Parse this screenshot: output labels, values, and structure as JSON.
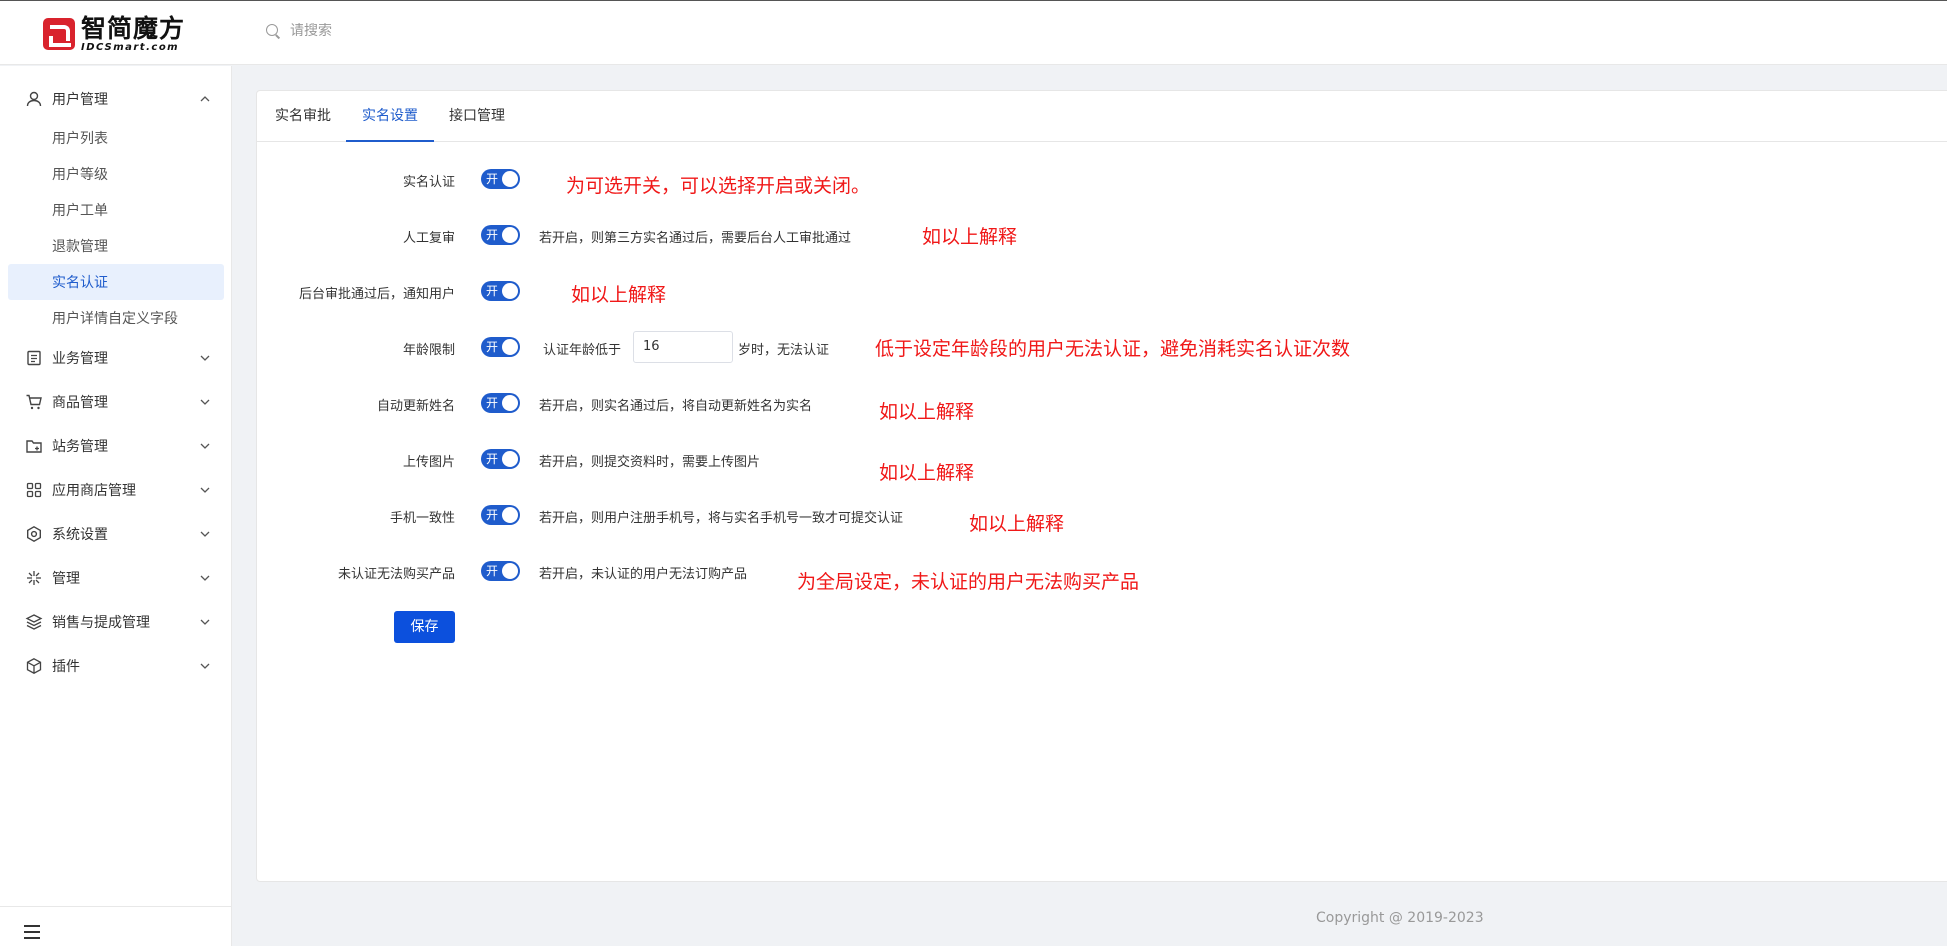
{
  "header": {
    "logo_cn": "智简魔方",
    "logo_en": "IDCSmart.com",
    "search_placeholder": "请搜索"
  },
  "sidebar": {
    "groups": [
      {
        "label": "用户管理",
        "icon": "user-icon",
        "expanded": true
      },
      {
        "label": "业务管理",
        "icon": "document-icon"
      },
      {
        "label": "商品管理",
        "icon": "cart-icon"
      },
      {
        "label": "站务管理",
        "icon": "folder-icon"
      },
      {
        "label": "应用商店管理",
        "icon": "apps-icon"
      },
      {
        "label": "系统设置",
        "icon": "settings-icon"
      },
      {
        "label": "管理",
        "icon": "sparkle-icon"
      },
      {
        "label": "销售与提成管理",
        "icon": "layers-icon"
      },
      {
        "label": "插件",
        "icon": "cube-icon"
      }
    ],
    "user_submenu": [
      {
        "label": "用户列表"
      },
      {
        "label": "用户等级"
      },
      {
        "label": "用户工单"
      },
      {
        "label": "退款管理"
      },
      {
        "label": "实名认证",
        "active": true
      },
      {
        "label": "用户详情自定义字段"
      }
    ]
  },
  "tabs": [
    {
      "label": "实名审批"
    },
    {
      "label": "实名设置",
      "active": true
    },
    {
      "label": "接口管理"
    }
  ],
  "settings": [
    {
      "label": "实名认证",
      "toggle": "开",
      "desc": "",
      "note": "为可选开关，可以选择开启或关闭。"
    },
    {
      "label": "人工复审",
      "toggle": "开",
      "desc": "若开启，则第三方实名通过后，需要后台人工审批通过",
      "note": "如以上解释"
    },
    {
      "label": "后台审批通过后，通知用户",
      "toggle": "开",
      "desc": "",
      "note": "如以上解释"
    },
    {
      "label": "年龄限制",
      "toggle": "开",
      "desc_prefix": "认证年龄低于",
      "age_value": "16",
      "desc_suffix": "岁时，无法认证",
      "note": "低于设定年龄段的用户无法认证，避免消耗实名认证次数"
    },
    {
      "label": "自动更新姓名",
      "toggle": "开",
      "desc": "若开启，则实名通过后，将自动更新姓名为实名",
      "note": "如以上解释"
    },
    {
      "label": "上传图片",
      "toggle": "开",
      "desc": "若开启，则提交资料时，需要上传图片",
      "note": "如以上解释"
    },
    {
      "label": "手机一致性",
      "toggle": "开",
      "desc": "若开启，则用户注册手机号，将与实名手机号一致才可提交认证",
      "note": "如以上解释"
    },
    {
      "label": "未认证无法购买产品",
      "toggle": "开",
      "desc": "若开启，未认证的用户无法订购产品",
      "note": "为全局设定，未认证的用户无法购买产品"
    }
  ],
  "save_label": "保存",
  "footer": {
    "copyright": "Copyright @ 2019-2023"
  },
  "colors": {
    "primary": "#1f5ccc",
    "annotation": "#f01818",
    "active_bg": "#e8f0fd"
  }
}
